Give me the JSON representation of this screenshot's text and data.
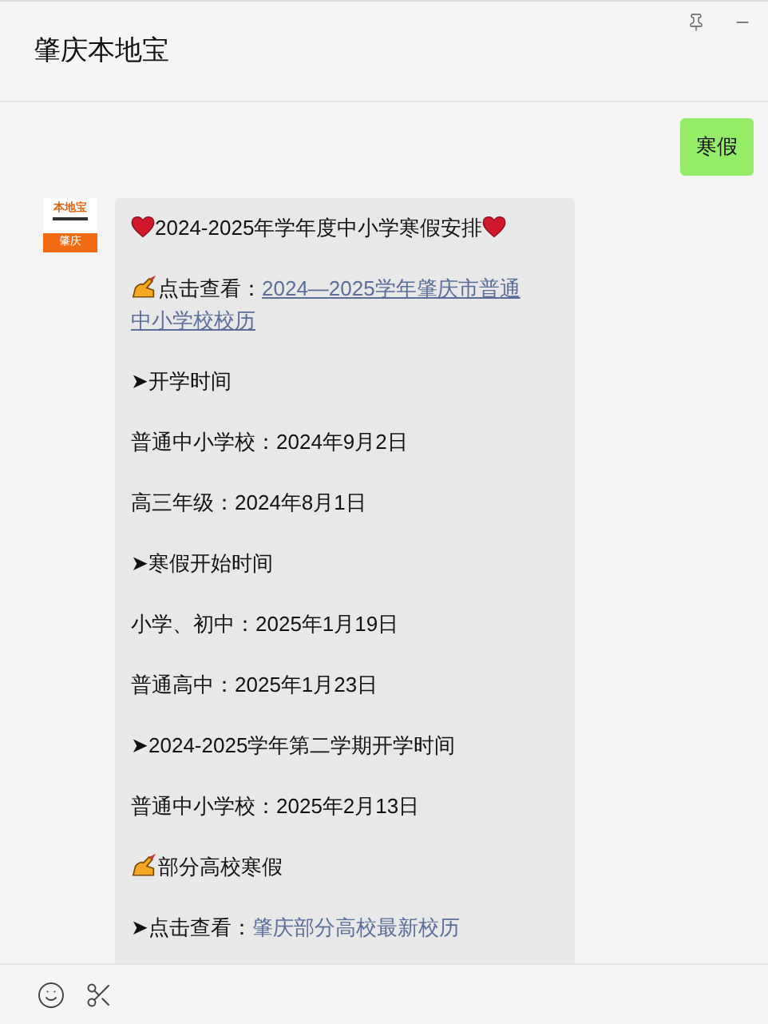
{
  "window": {
    "title": "肇庆本地宝"
  },
  "messages": [
    {
      "kind": "sent",
      "text": "寒假"
    },
    {
      "kind": "received",
      "avatar": {
        "brand": "本地宝",
        "city": "肇庆"
      },
      "lines": [
        {
          "kind": "heading",
          "text": "2024-2025年学年度中小学寒假安排"
        },
        {
          "kind": "hand-link",
          "prefix": "点击查看：",
          "link_lines": [
            "2024—2025学年肇庆市普通",
            "中小学校校历"
          ],
          "underlined": true
        },
        {
          "kind": "text",
          "text": "➤开学时间"
        },
        {
          "kind": "text",
          "text": "普通中小学校：2024年9月2日"
        },
        {
          "kind": "text",
          "text": "高三年级：2024年8月1日"
        },
        {
          "kind": "text",
          "text": "➤寒假开始时间"
        },
        {
          "kind": "text",
          "text": "小学、初中：2025年1月19日"
        },
        {
          "kind": "text",
          "text": "普通高中：2025年1月23日"
        },
        {
          "kind": "text",
          "text": "➤2024-2025学年第二学期开学时间"
        },
        {
          "kind": "text",
          "text": "普通中小学校：2025年2月13日"
        },
        {
          "kind": "hand",
          "text": "部分高校寒假"
        },
        {
          "kind": "link",
          "prefix": "➤点击查看：",
          "link": "肇庆部分高校最新校历",
          "underlined": false
        }
      ]
    }
  ]
}
